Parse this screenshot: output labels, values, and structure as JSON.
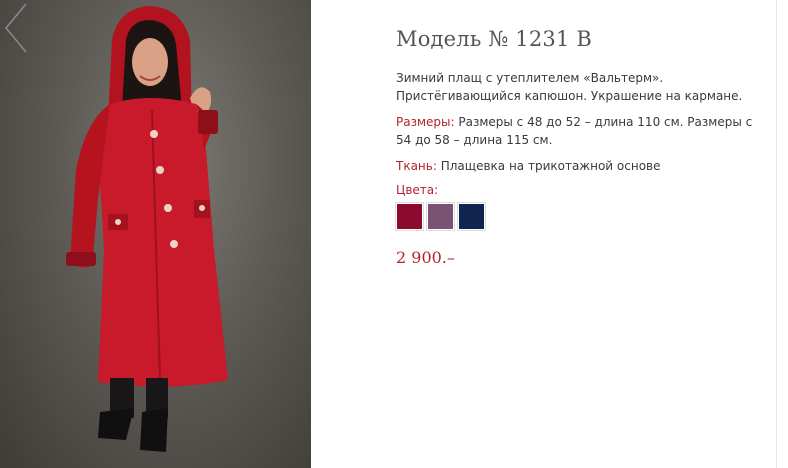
{
  "product": {
    "title": "Модель № 1231 В",
    "description": "Зимний плащ с утеплителем «Вальтерм». Пристёгивающийся капюшон. Украшение на кармане.",
    "sizes_label": "Размеры:",
    "sizes_value": " Размеры с 48 до 52 – длина 110 см. Размеры с 54 до 58 – длина 115 см.",
    "fabric_label": "Ткань:",
    "fabric_value": " Плащевка на трикотажной основе",
    "colors_label": "Цвета:",
    "colors": [
      {
        "name": "burgundy",
        "hex": "#8c0a2e"
      },
      {
        "name": "mauve",
        "hex": "#7a5273"
      },
      {
        "name": "navy",
        "hex": "#0f2550"
      }
    ],
    "price": "2 900.–"
  },
  "gallery": {
    "prev_icon": "chevron-left-icon"
  },
  "theme": {
    "accent": "#b4232b",
    "coat": "#c81a2a"
  }
}
